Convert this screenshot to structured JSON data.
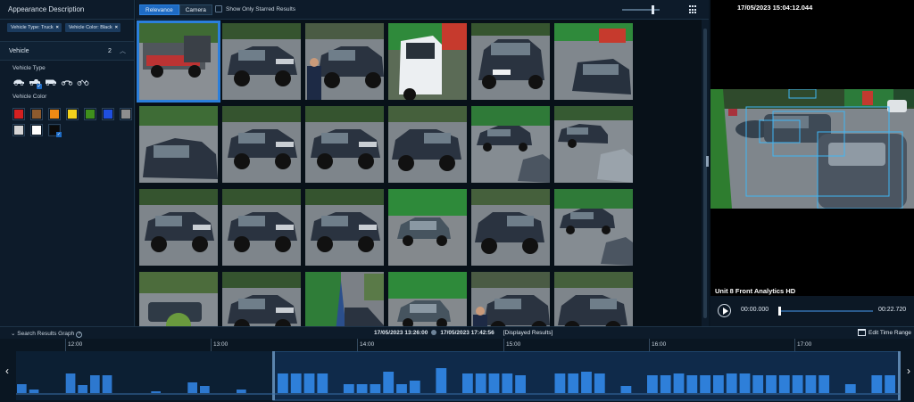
{
  "left_panel": {
    "title": "Appearance Description",
    "chips": [
      {
        "label": "Vehicle Type: Truck"
      },
      {
        "label": "Vehicle Color: Black"
      }
    ],
    "vehicle_section": {
      "label": "Vehicle",
      "count": "2"
    },
    "vehicle_type_label": "Vehicle Type",
    "vehicle_color_label": "Vehicle Color",
    "vehicle_types": [
      {
        "icon": "car-icon",
        "selected": false
      },
      {
        "icon": "truck-icon",
        "selected": true
      },
      {
        "icon": "van-icon",
        "selected": false
      },
      {
        "icon": "motorcycle-icon",
        "selected": false
      },
      {
        "icon": "bicycle-icon",
        "selected": false
      }
    ],
    "colors": [
      {
        "hex": "#d42020",
        "selected": false
      },
      {
        "hex": "#8c5a2e",
        "selected": false
      },
      {
        "hex": "#f08a14",
        "selected": false
      },
      {
        "hex": "#f2d21c",
        "selected": false
      },
      {
        "hex": "#3f8f1c",
        "selected": false
      },
      {
        "hex": "#1f4fe0",
        "selected": false
      },
      {
        "hex": "#8e8e8e",
        "selected": false
      },
      {
        "hex": "#d4d4d4",
        "selected": false
      },
      {
        "hex": "#ffffff",
        "selected": false
      },
      {
        "hex": "#0b0b0b",
        "selected": true
      }
    ]
  },
  "toolbar": {
    "sort_options": [
      {
        "label": "Relevance",
        "active": true
      },
      {
        "label": "Camera",
        "active": false
      }
    ],
    "starred_label": "Show Only Starred Results",
    "zoom_level": 0.8
  },
  "results": [
    {
      "scene": "flatbed",
      "selected": true
    },
    {
      "scene": "pickup-left",
      "selected": false
    },
    {
      "scene": "pickup-person",
      "selected": false
    },
    {
      "scene": "white-van",
      "selected": false
    },
    {
      "scene": "pickup-front",
      "selected": false
    },
    {
      "scene": "suv-rear",
      "selected": false
    },
    {
      "scene": "car-rear",
      "selected": false
    },
    {
      "scene": "pickup-left",
      "selected": false
    },
    {
      "scene": "pickup-left",
      "selected": false
    },
    {
      "scene": "pickup-right",
      "selected": false
    },
    {
      "scene": "pickup-far",
      "selected": false
    },
    {
      "scene": "car-lot",
      "selected": false
    },
    {
      "scene": "pickup-left",
      "selected": false
    },
    {
      "scene": "pickup-left",
      "selected": false
    },
    {
      "scene": "pickup-left",
      "selected": false
    },
    {
      "scene": "hatch-green",
      "selected": false
    },
    {
      "scene": "pickup-right",
      "selected": false
    },
    {
      "scene": "pickup-far",
      "selected": false
    },
    {
      "scene": "hedge-car",
      "selected": false
    },
    {
      "scene": "pickup-left",
      "selected": false
    },
    {
      "scene": "umbrella",
      "selected": false
    },
    {
      "scene": "hatch-green",
      "selected": false
    },
    {
      "scene": "pickup-person",
      "selected": false
    },
    {
      "scene": "pickup-right",
      "selected": false
    }
  ],
  "video": {
    "timestamp": "17/05/2023 15:04:12.044",
    "camera": "Unit 8 Front Analytics HD",
    "current_time": "00:00.000",
    "duration": "00:22.720",
    "progress": 0.0
  },
  "timeline": {
    "title": "Search Results Graph",
    "range_start": "17/05/2023 13:26:00",
    "range_end": "17/05/2023 17:42:56",
    "displayed_label": "[Displayed Results]",
    "edit_label": "Edit Time Range",
    "ticks": [
      "12:00",
      "13:00",
      "14:00",
      "15:00",
      "16:00",
      "17:00"
    ],
    "bars_before": [
      10,
      4,
      0,
      0,
      22,
      9,
      20,
      20,
      0,
      0,
      0,
      2,
      0,
      0,
      12,
      8,
      0,
      0,
      4,
      0,
      0
    ],
    "bars_after": [
      22,
      22,
      22,
      22,
      0,
      10,
      10,
      10,
      24,
      10,
      14,
      0,
      28,
      0,
      22,
      22,
      22,
      22,
      20,
      0,
      0,
      22,
      22,
      24,
      22,
      0,
      8,
      0,
      20,
      20,
      22,
      20,
      20,
      20,
      22,
      22,
      20,
      20,
      20,
      20,
      20,
      20,
      0,
      10,
      0,
      20,
      20
    ]
  }
}
